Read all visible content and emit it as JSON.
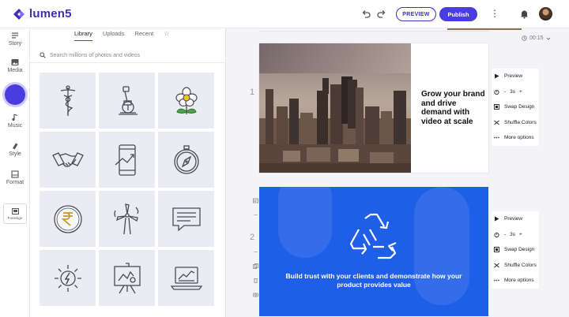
{
  "app": {
    "logo_text": "lumen5"
  },
  "header": {
    "preview_label": "PREVIEW",
    "publish_label": "Publish",
    "more_glyph": "⋮"
  },
  "rail": {
    "items": [
      {
        "label": "Story",
        "icon": "story-icon"
      },
      {
        "label": "Media",
        "icon": "media-icon"
      },
      {
        "label": "Music",
        "icon": "music-icon"
      },
      {
        "label": "Style",
        "icon": "style-icon"
      },
      {
        "label": "Format",
        "icon": "format-icon"
      }
    ],
    "footer_label": "Fonesign"
  },
  "library": {
    "tabs": [
      "Library",
      "Uploads",
      "Recent"
    ],
    "active_tab": "Library",
    "favorites_glyph": "☆",
    "search_placeholder": "Search millions of photos and videos",
    "icons": [
      "caduceus-icon",
      "microscope-icon",
      "flower-icon",
      "handshake-icon",
      "growth-phone-icon",
      "compass-icon",
      "rupee-coin-icon",
      "wind-turbine-icon",
      "chat-bubble-icon",
      "solar-energy-icon",
      "presentation-board-icon",
      "laptop-chart-icon"
    ]
  },
  "canvas": {
    "duration": "00:15",
    "scenes": [
      {
        "number": "1",
        "text": "Grow your brand and drive demand with video at scale"
      },
      {
        "number": "2",
        "text": "Build trust with your clients and demonstrate how your product provides value"
      }
    ],
    "accent_blue": "#1f5fe8"
  },
  "scene_menu": {
    "preview": "Preview",
    "duration_value": "3s",
    "minus": "-",
    "plus": "+",
    "swap_design": "Swap Design",
    "shuffle_colors": "Shuffle Colors",
    "more_options": "More options"
  }
}
